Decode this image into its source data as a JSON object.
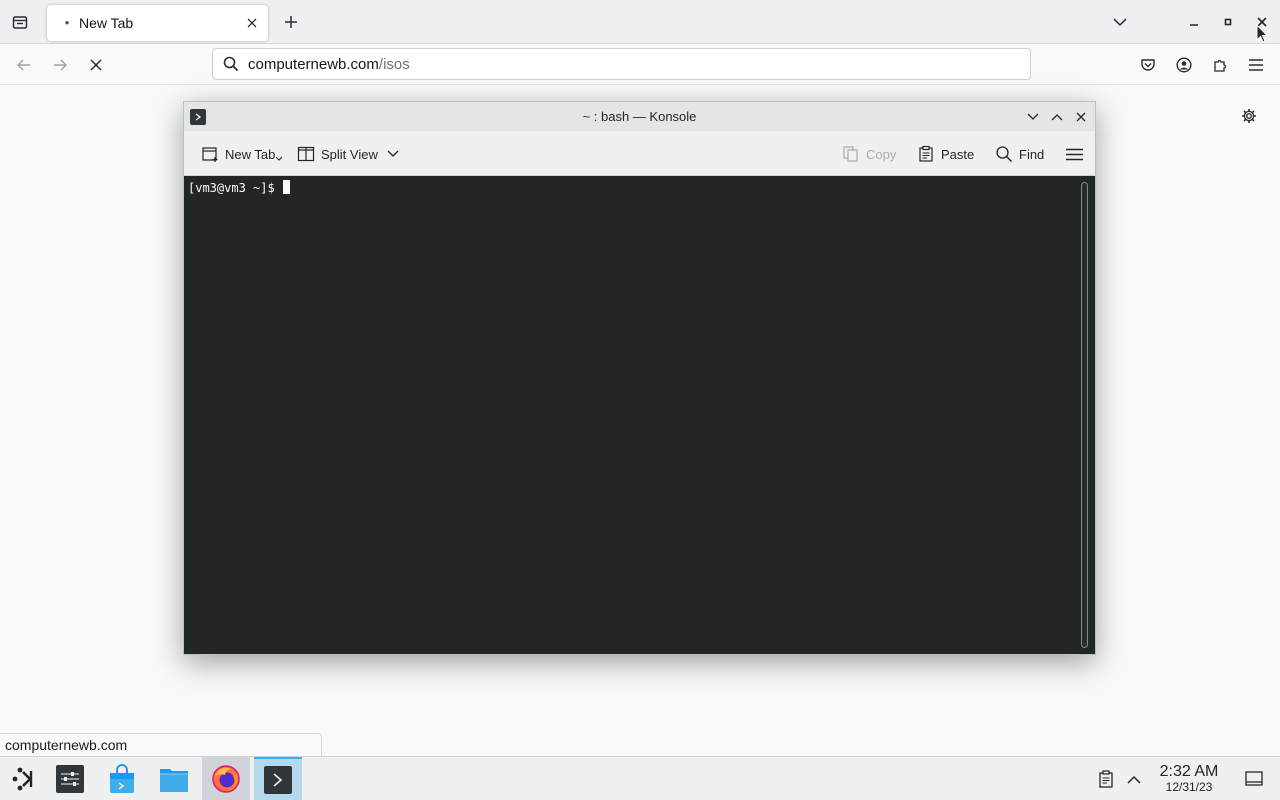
{
  "browser": {
    "tab": {
      "title": "New Tab",
      "loading_glyph": "•"
    },
    "urlbar": {
      "host": "computernewb.com",
      "path": "/isos"
    },
    "status_url": "computernewb.com"
  },
  "konsole": {
    "title": "~ : bash — Konsole",
    "toolbar": {
      "new_tab": "New Tab",
      "split_view": "Split View",
      "copy": "Copy",
      "paste": "Paste",
      "find": "Find"
    },
    "terminal": {
      "prompt": "[vm3@vm3 ~]$ "
    }
  },
  "taskbar": {
    "clock": {
      "time": "2:32 AM",
      "date": "12/31/23"
    }
  },
  "colors": {
    "terminal_bg": "#232627",
    "accent": "#3daee9",
    "firefox_orange": "#ff7139"
  }
}
